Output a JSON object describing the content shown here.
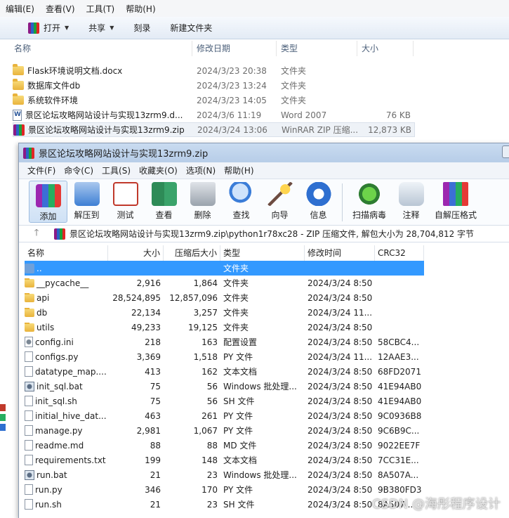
{
  "explorer": {
    "menu": [
      "编辑(E)",
      "查看(V)",
      "工具(T)",
      "帮助(H)"
    ],
    "toolbar": {
      "open": "打开",
      "share": "共享",
      "burn": "刻录",
      "new_folder": "新建文件夹"
    },
    "columns": {
      "name": "名称",
      "date": "修改日期",
      "type": "类型",
      "size": "大小"
    },
    "rows": [
      {
        "name": "Flask环境说明文档.docx",
        "date": "2024/3/23 20:38",
        "type": "文件夹",
        "size": "",
        "icon": "folder"
      },
      {
        "name": "数据库文件db",
        "date": "2024/3/23 13:24",
        "type": "文件夹",
        "size": "",
        "icon": "folder"
      },
      {
        "name": "系统软件环境",
        "date": "2024/3/23 14:05",
        "type": "文件夹",
        "size": "",
        "icon": "folder"
      },
      {
        "name": "景区论坛攻略网站设计与实现13zrm9.d...",
        "date": "2024/3/6 11:19",
        "type": "Word 2007",
        "size": "76 KB",
        "icon": "word"
      },
      {
        "name": "景区论坛攻略网站设计与实现13zrm9.zip",
        "date": "2024/3/24 13:06",
        "type": "WinRAR ZIP 压缩...",
        "size": "12,873 KB",
        "icon": "rar"
      }
    ]
  },
  "winrar": {
    "title": "景区论坛攻略网站设计与实现13zrm9.zip",
    "menu": [
      "文件(F)",
      "命令(C)",
      "工具(S)",
      "收藏夹(O)",
      "选项(N)",
      "帮助(H)"
    ],
    "tools": [
      "添加",
      "解压到",
      "测试",
      "查看",
      "删除",
      "查找",
      "向导",
      "信息",
      "扫描病毒",
      "注释",
      "自解压格式"
    ],
    "path": "景区论坛攻略网站设计与实现13zrm9.zip\\python1r78xc28 - ZIP 压缩文件, 解包大小为 28,704,812 字节",
    "columns": {
      "name": "名称",
      "size": "大小",
      "packed": "压缩后大小",
      "type": "类型",
      "modified": "修改时间",
      "crc": "CRC32"
    },
    "rows": [
      {
        "name": "..",
        "size": "",
        "packed": "",
        "type": "文件夹",
        "modified": "",
        "crc": "",
        "icon": "up"
      },
      {
        "name": "__pycache__",
        "size": "2,916",
        "packed": "1,864",
        "type": "文件夹",
        "modified": "2024/3/24 8:50",
        "crc": "",
        "icon": "folder"
      },
      {
        "name": "api",
        "size": "28,524,895",
        "packed": "12,857,096",
        "type": "文件夹",
        "modified": "2024/3/24 8:50",
        "crc": "",
        "icon": "folder"
      },
      {
        "name": "db",
        "size": "22,134",
        "packed": "3,257",
        "type": "文件夹",
        "modified": "2024/3/24 11...",
        "crc": "",
        "icon": "folder"
      },
      {
        "name": "utils",
        "size": "49,233",
        "packed": "19,125",
        "type": "文件夹",
        "modified": "2024/3/24 8:50",
        "crc": "",
        "icon": "folder"
      },
      {
        "name": "config.ini",
        "size": "218",
        "packed": "163",
        "type": "配置设置",
        "modified": "2024/3/24 8:50",
        "crc": "58CBC4...",
        "icon": "gear"
      },
      {
        "name": "configs.py",
        "size": "3,369",
        "packed": "1,518",
        "type": "PY 文件",
        "modified": "2024/3/24 11...",
        "crc": "12AAE3...",
        "icon": "file"
      },
      {
        "name": "datatype_map....",
        "size": "413",
        "packed": "162",
        "type": "文本文档",
        "modified": "2024/3/24 8:50",
        "crc": "68FD2071",
        "icon": "file"
      },
      {
        "name": "init_sql.bat",
        "size": "75",
        "packed": "56",
        "type": "Windows 批处理...",
        "modified": "2024/3/24 8:50",
        "crc": "41E94AB0",
        "icon": "bat"
      },
      {
        "name": "init_sql.sh",
        "size": "75",
        "packed": "56",
        "type": "SH 文件",
        "modified": "2024/3/24 8:50",
        "crc": "41E94AB0",
        "icon": "file"
      },
      {
        "name": "initial_hive_dat...",
        "size": "463",
        "packed": "261",
        "type": "PY 文件",
        "modified": "2024/3/24 8:50",
        "crc": "9C0936B8",
        "icon": "file"
      },
      {
        "name": "manage.py",
        "size": "2,981",
        "packed": "1,067",
        "type": "PY 文件",
        "modified": "2024/3/24 8:50",
        "crc": "9C6B9C...",
        "icon": "file"
      },
      {
        "name": "readme.md",
        "size": "88",
        "packed": "88",
        "type": "MD 文件",
        "modified": "2024/3/24 8:50",
        "crc": "9022EE7F",
        "icon": "file"
      },
      {
        "name": "requirements.txt",
        "size": "199",
        "packed": "148",
        "type": "文本文档",
        "modified": "2024/3/24 8:50",
        "crc": "7CC31E...",
        "icon": "file"
      },
      {
        "name": "run.bat",
        "size": "21",
        "packed": "23",
        "type": "Windows 批处理...",
        "modified": "2024/3/24 8:50",
        "crc": "8A507A...",
        "icon": "bat"
      },
      {
        "name": "run.py",
        "size": "346",
        "packed": "170",
        "type": "PY 文件",
        "modified": "2024/3/24 8:50",
        "crc": "9B380FD3",
        "icon": "file"
      },
      {
        "name": "run.sh",
        "size": "21",
        "packed": "23",
        "type": "SH 文件",
        "modified": "2024/3/24 8:50",
        "crc": "8A507...",
        "icon": "file"
      }
    ]
  },
  "watermark": "CSDN @海彤程序设计"
}
